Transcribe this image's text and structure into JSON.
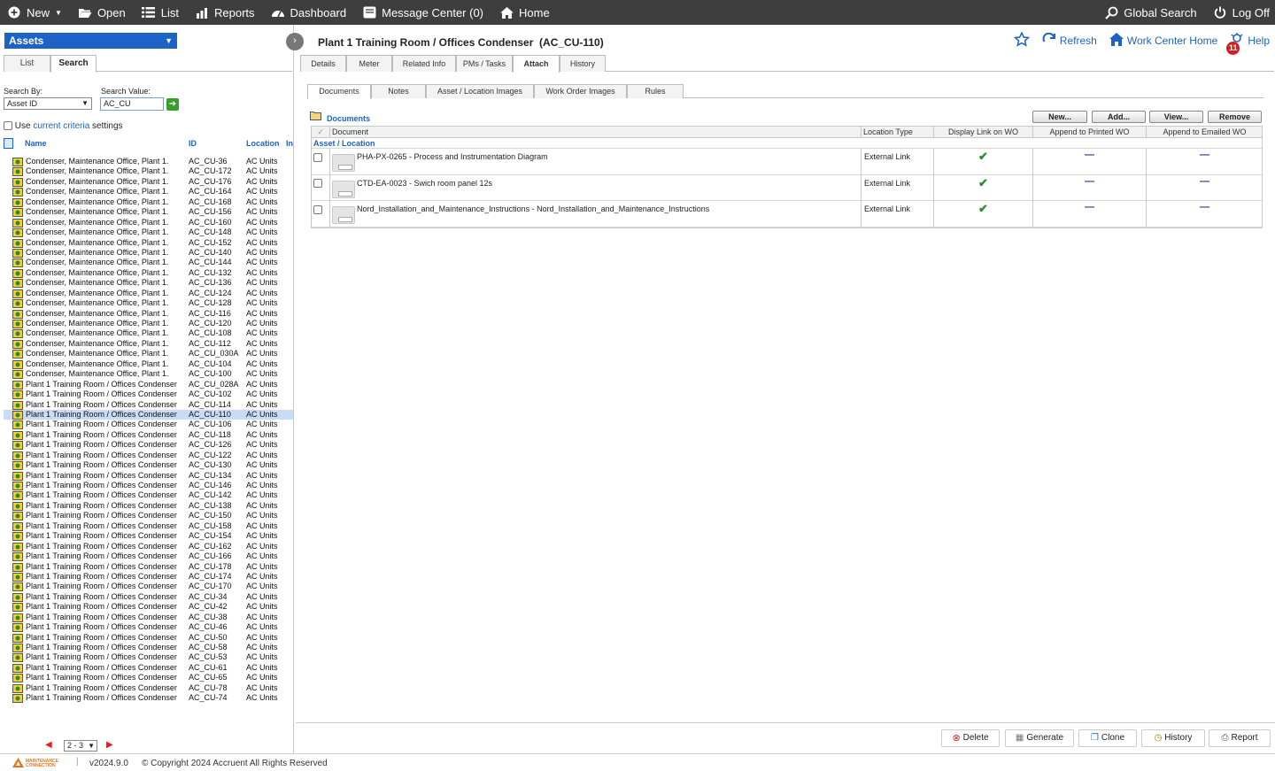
{
  "topbar": {
    "new": "New",
    "open": "Open",
    "list": "List",
    "reports": "Reports",
    "dashboard": "Dashboard",
    "message_center": "Message Center (0)",
    "home": "Home",
    "global_search": "Global Search",
    "log_off": "Log Off"
  },
  "left": {
    "module": "Assets",
    "tabs": [
      "List",
      "Search"
    ],
    "active_tab": "Search",
    "search_by_label": "Search By:",
    "search_by_value": "Asset ID",
    "search_value_label": "Search Value:",
    "search_value": "AC_CU",
    "use_prefix": "Use",
    "current_criteria": "current criteria",
    "settings_suffix": "settings",
    "columns": [
      "Name",
      "ID",
      "Location",
      "In"
    ],
    "rows": [
      {
        "name": "Condenser, Maintenance Office, Plant 1.",
        "id": "AC_CU-36",
        "loc": "AC Units"
      },
      {
        "name": "Condenser, Maintenance Office, Plant 1.",
        "id": "AC_CU-172",
        "loc": "AC Units"
      },
      {
        "name": "Condenser, Maintenance Office, Plant 1.",
        "id": "AC_CU-176",
        "loc": "AC Units"
      },
      {
        "name": "Condenser, Maintenance Office, Plant 1.",
        "id": "AC_CU-164",
        "loc": "AC Units"
      },
      {
        "name": "Condenser, Maintenance Office, Plant 1.",
        "id": "AC_CU-168",
        "loc": "AC Units"
      },
      {
        "name": "Condenser, Maintenance Office, Plant 1.",
        "id": "AC_CU-156",
        "loc": "AC Units"
      },
      {
        "name": "Condenser, Maintenance Office, Plant 1.",
        "id": "AC_CU-160",
        "loc": "AC Units"
      },
      {
        "name": "Condenser, Maintenance Office, Plant 1.",
        "id": "AC_CU-148",
        "loc": "AC Units"
      },
      {
        "name": "Condenser, Maintenance Office, Plant 1.",
        "id": "AC_CU-152",
        "loc": "AC Units"
      },
      {
        "name": "Condenser, Maintenance Office, Plant 1.",
        "id": "AC_CU-140",
        "loc": "AC Units"
      },
      {
        "name": "Condenser, Maintenance Office, Plant 1.",
        "id": "AC_CU-144",
        "loc": "AC Units"
      },
      {
        "name": "Condenser, Maintenance Office, Plant 1.",
        "id": "AC_CU-132",
        "loc": "AC Units"
      },
      {
        "name": "Condenser, Maintenance Office, Plant 1.",
        "id": "AC_CU-136",
        "loc": "AC Units"
      },
      {
        "name": "Condenser, Maintenance Office, Plant 1.",
        "id": "AC_CU-124",
        "loc": "AC Units"
      },
      {
        "name": "Condenser, Maintenance Office, Plant 1.",
        "id": "AC_CU-128",
        "loc": "AC Units"
      },
      {
        "name": "Condenser, Maintenance Office, Plant 1.",
        "id": "AC_CU-116",
        "loc": "AC Units"
      },
      {
        "name": "Condenser, Maintenance Office, Plant 1.",
        "id": "AC_CU-120",
        "loc": "AC Units"
      },
      {
        "name": "Condenser, Maintenance Office, Plant 1.",
        "id": "AC_CU-108",
        "loc": "AC Units"
      },
      {
        "name": "Condenser, Maintenance Office, Plant 1.",
        "id": "AC_CU-112",
        "loc": "AC Units"
      },
      {
        "name": "Condenser, Maintenance Office, Plant 1.",
        "id": "AC_CU_030A",
        "loc": "AC Units"
      },
      {
        "name": "Condenser, Maintenance Office, Plant 1.",
        "id": "AC_CU-104",
        "loc": "AC Units"
      },
      {
        "name": "Condenser, Maintenance Office, Plant 1.",
        "id": "AC_CU-100",
        "loc": "AC Units"
      },
      {
        "name": "Plant 1 Training Room / Offices Condenser",
        "id": "AC_CU_028A",
        "loc": "AC Units"
      },
      {
        "name": "Plant 1 Training Room / Offices Condenser",
        "id": "AC_CU-102",
        "loc": "AC Units"
      },
      {
        "name": "Plant 1 Training Room / Offices Condenser",
        "id": "AC_CU-114",
        "loc": "AC Units"
      },
      {
        "name": "Plant 1 Training Room / Offices Condenser",
        "id": "AC_CU-110",
        "loc": "AC Units",
        "selected": true
      },
      {
        "name": "Plant 1 Training Room / Offices Condenser",
        "id": "AC_CU-106",
        "loc": "AC Units"
      },
      {
        "name": "Plant 1 Training Room / Offices Condenser",
        "id": "AC_CU-118",
        "loc": "AC Units"
      },
      {
        "name": "Plant 1 Training Room / Offices Condenser",
        "id": "AC_CU-126",
        "loc": "AC Units"
      },
      {
        "name": "Plant 1 Training Room / Offices Condenser",
        "id": "AC_CU-122",
        "loc": "AC Units"
      },
      {
        "name": "Plant 1 Training Room / Offices Condenser",
        "id": "AC_CU-130",
        "loc": "AC Units"
      },
      {
        "name": "Plant 1 Training Room / Offices Condenser",
        "id": "AC_CU-134",
        "loc": "AC Units"
      },
      {
        "name": "Plant 1 Training Room / Offices Condenser",
        "id": "AC_CU-146",
        "loc": "AC Units"
      },
      {
        "name": "Plant 1 Training Room / Offices Condenser",
        "id": "AC_CU-142",
        "loc": "AC Units"
      },
      {
        "name": "Plant 1 Training Room / Offices Condenser",
        "id": "AC_CU-138",
        "loc": "AC Units"
      },
      {
        "name": "Plant 1 Training Room / Offices Condenser",
        "id": "AC_CU-150",
        "loc": "AC Units"
      },
      {
        "name": "Plant 1 Training Room / Offices Condenser",
        "id": "AC_CU-158",
        "loc": "AC Units"
      },
      {
        "name": "Plant 1 Training Room / Offices Condenser",
        "id": "AC_CU-154",
        "loc": "AC Units"
      },
      {
        "name": "Plant 1 Training Room / Offices Condenser",
        "id": "AC_CU-162",
        "loc": "AC Units"
      },
      {
        "name": "Plant 1 Training Room / Offices Condenser",
        "id": "AC_CU-166",
        "loc": "AC Units"
      },
      {
        "name": "Plant 1 Training Room / Offices Condenser",
        "id": "AC_CU-178",
        "loc": "AC Units"
      },
      {
        "name": "Plant 1 Training Room / Offices Condenser",
        "id": "AC_CU-174",
        "loc": "AC Units"
      },
      {
        "name": "Plant 1 Training Room / Offices Condenser",
        "id": "AC_CU-170",
        "loc": "AC Units"
      },
      {
        "name": "Plant 1 Training Room / Offices Condenser",
        "id": "AC_CU-34",
        "loc": "AC Units"
      },
      {
        "name": "Plant 1 Training Room / Offices Condenser",
        "id": "AC_CU-42",
        "loc": "AC Units"
      },
      {
        "name": "Plant 1 Training Room / Offices Condenser",
        "id": "AC_CU-38",
        "loc": "AC Units"
      },
      {
        "name": "Plant 1 Training Room / Offices Condenser",
        "id": "AC_CU-46",
        "loc": "AC Units"
      },
      {
        "name": "Plant 1 Training Room / Offices Condenser",
        "id": "AC_CU-50",
        "loc": "AC Units"
      },
      {
        "name": "Plant 1 Training Room / Offices Condenser",
        "id": "AC_CU-58",
        "loc": "AC Units"
      },
      {
        "name": "Plant 1 Training Room / Offices Condenser",
        "id": "AC_CU-53",
        "loc": "AC Units"
      },
      {
        "name": "Plant 1 Training Room / Offices Condenser",
        "id": "AC_CU-61",
        "loc": "AC Units"
      },
      {
        "name": "Plant 1 Training Room / Offices Condenser",
        "id": "AC_CU-65",
        "loc": "AC Units"
      },
      {
        "name": "Plant 1 Training Room / Offices Condenser",
        "id": "AC_CU-78",
        "loc": "AC Units"
      },
      {
        "name": "Plant 1 Training Room / Offices Condenser",
        "id": "AC_CU-74",
        "loc": "AC Units"
      }
    ],
    "pager_value": "2 - 3"
  },
  "main": {
    "title": "Plant 1 Training Room / Offices Condenser  (AC_CU-110)",
    "refresh": "Refresh",
    "work_center_home": "Work Center Home",
    "help": "Help",
    "help_badge": "11",
    "tabs": [
      "Details",
      "Meter",
      "Related Info",
      "PMs / Tasks",
      "Attach",
      "History"
    ],
    "active_tab": "Attach",
    "subtabs": [
      "Documents",
      "Notes",
      "Asset / Location Images",
      "Work Order Images",
      "Rules"
    ],
    "active_subtab": "Documents",
    "docs_title": "Documents",
    "buttons": {
      "new": "New...",
      "add": "Add...",
      "view": "View...",
      "remove": "Remove"
    },
    "doc_columns": [
      "Document",
      "Location Type",
      "Display Link on WO",
      "Append to Printed WO",
      "Append to Emailed WO"
    ],
    "group_label": "Asset / Location",
    "documents": [
      {
        "name": "PHA-PX-0265 - Process and Instrumentation Diagram",
        "location_type": "External Link",
        "display_link": true,
        "printed": false,
        "emailed": false
      },
      {
        "name": "CTD-EA-0023 - Swich room panel 12s",
        "location_type": "External Link",
        "display_link": true,
        "printed": false,
        "emailed": false
      },
      {
        "name": "Nord_Installation_and_Maintenance_Instructions - Nord_Installation_and_Maintenance_Instructions",
        "location_type": "External Link",
        "display_link": true,
        "printed": false,
        "emailed": false
      }
    ],
    "bottom_buttons": {
      "delete": "Delete",
      "generate": "Generate",
      "clone": "Clone",
      "history": "History",
      "report": "Report"
    }
  },
  "footer": {
    "logo_text_1": "MAINTENANCE",
    "logo_text_2": "CONNECTION",
    "version": "v2024.9.0",
    "copyright": "© Copyright 2024 Accruent All Rights Reserved"
  }
}
